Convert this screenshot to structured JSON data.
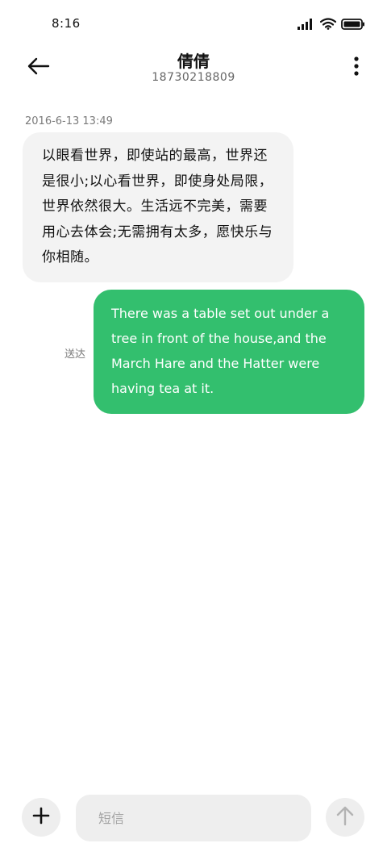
{
  "status_bar": {
    "time": "8:16",
    "icons": [
      "signal-icon",
      "wifi-icon",
      "battery-icon"
    ]
  },
  "header": {
    "contact_name": "倩倩",
    "contact_number": "18730218809"
  },
  "conversation": {
    "timestamp": "2016-6-13 13:49",
    "received_message": "以眼看世界，即使站的最高，世界还是很小;以心看世界，即使身处局限，世界依然很大。生活远不完美，需要用心去体会;无需拥有太多，愿快乐与你相随。",
    "sent_status": "送达",
    "sent_message": "There was a table set out under a tree in front of the house,and the March Hare and the Hatter were having tea at it."
  },
  "composer": {
    "placeholder": "短信",
    "value": ""
  },
  "colors": {
    "sent_bubble": "#33bf6e",
    "received_bubble": "#f3f3f3",
    "control_bg": "#eeeeee"
  }
}
